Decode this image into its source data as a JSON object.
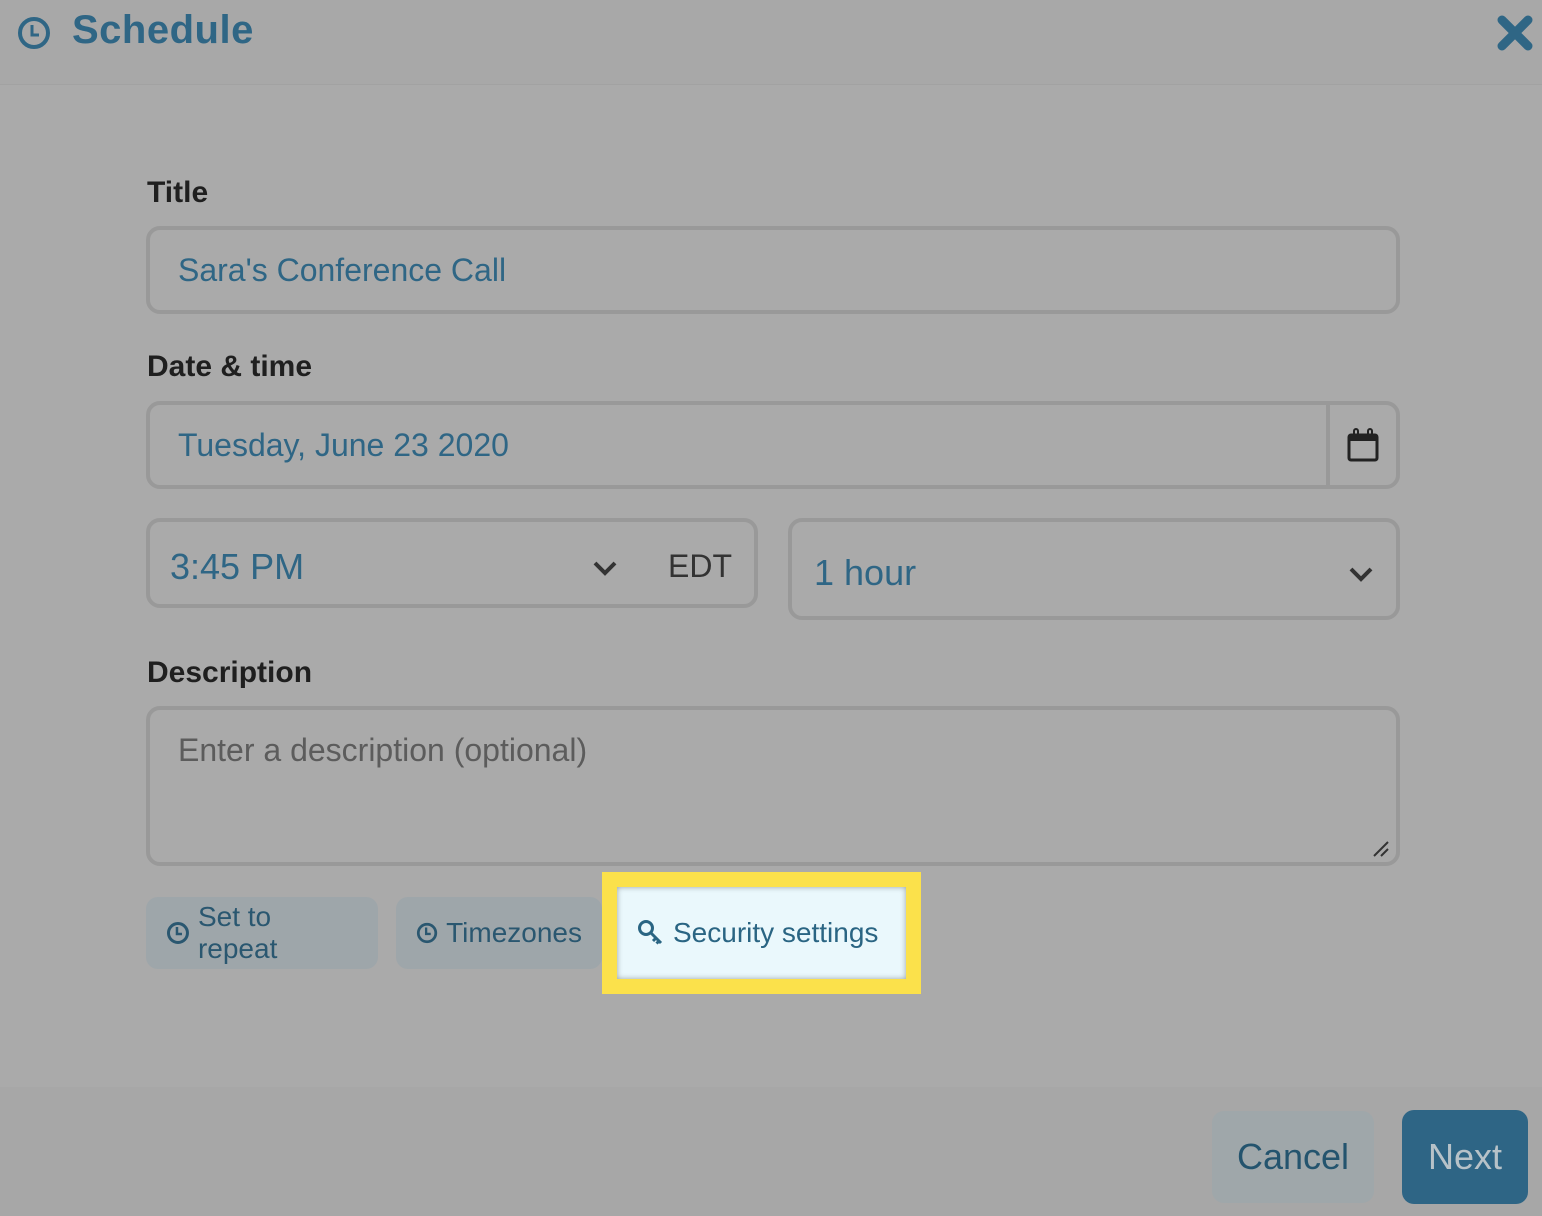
{
  "header": {
    "title": "Schedule",
    "icon": "clock-icon",
    "close_icon": "close-icon"
  },
  "form": {
    "title_label": "Title",
    "title_value": "Sara's Conference Call",
    "datetime_label": "Date & time",
    "date_value": "Tuesday, June 23 2020",
    "calendar_icon": "calendar-icon",
    "time_value": "3:45 PM",
    "timezone": "EDT",
    "duration_value": "1 hour",
    "description_label": "Description",
    "description_placeholder": "Enter a description (optional)",
    "description_value": ""
  },
  "options": {
    "repeat_label": "Set to repeat",
    "timezones_label": "Timezones",
    "security_label": "Security settings"
  },
  "footer": {
    "cancel_label": "Cancel",
    "next_label": "Next"
  },
  "colors": {
    "accent": "#2f6685",
    "highlight": "#fbe14b",
    "next_button": "#2e6585"
  }
}
